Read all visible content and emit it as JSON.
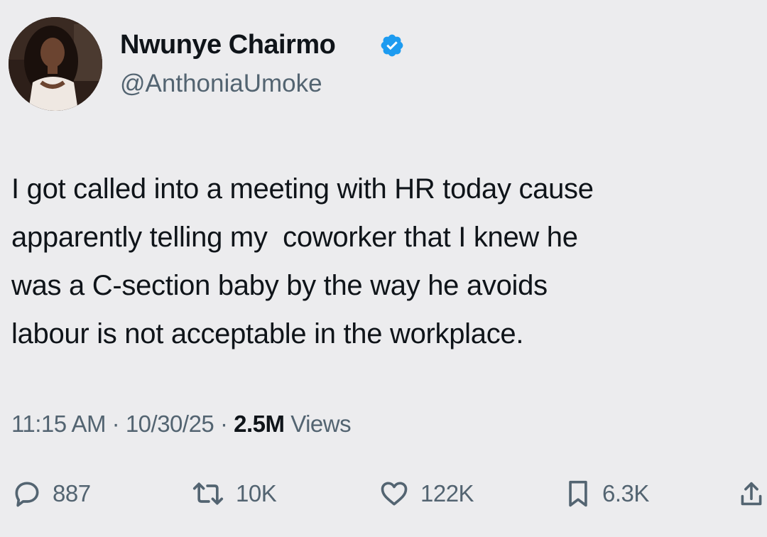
{
  "tweet": {
    "author": {
      "name": "Nwunye Chairmo",
      "handle": "@AnthoniaUmoke",
      "avatar_icon": "profile-photo",
      "verified_icon": "verified-badge-icon",
      "verified_color": "#1d9bf0"
    },
    "text_lines": [
      "I got called into a meeting with HR today cause",
      "apparently telling my  coworker that I knew he",
      "was a C-section baby by the way he avoids",
      "labour is not acceptable in the workplace."
    ],
    "meta": {
      "time": "11:15 AM",
      "separator": "·",
      "date": "10/30/25",
      "views_count": "2.5M",
      "views_label": "Views"
    },
    "actions": {
      "reply": {
        "icon": "reply-icon",
        "count": "887"
      },
      "repost": {
        "icon": "repost-icon",
        "count": "10K"
      },
      "like": {
        "icon": "heart-icon",
        "count": "122K"
      },
      "bookmark": {
        "icon": "bookmark-icon",
        "count": "6.3K"
      },
      "share": {
        "icon": "share-icon"
      }
    }
  }
}
